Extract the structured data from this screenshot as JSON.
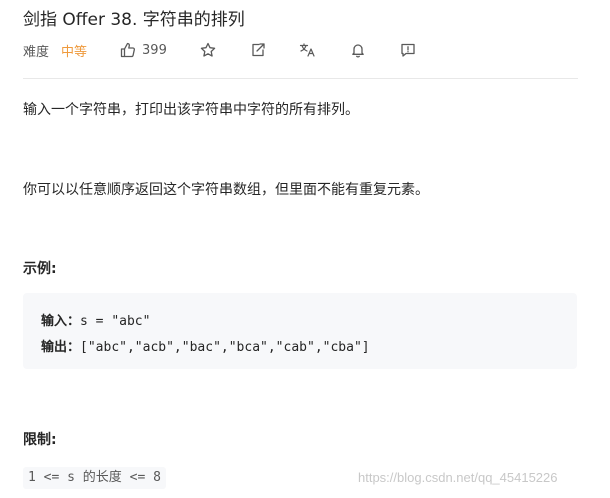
{
  "problem": {
    "title": "剑指 Offer 38. 字符串的排列",
    "difficulty_label": "难度",
    "difficulty": "中等",
    "likes": "399"
  },
  "toolbar_icons": [
    "thumbs-up-icon",
    "star-icon",
    "share-icon",
    "translate-icon",
    "bell-icon",
    "feedback-icon"
  ],
  "description": {
    "p1": "输入一个字符串，打印出该字符串中字符的所有排列。",
    "p2": "你可以以任意顺序返回这个字符串数组，但里面不能有重复元素。"
  },
  "example": {
    "heading": "示例:",
    "input_label": "输入：",
    "input_value": "s = \"abc\"",
    "output_label": "输出：",
    "output_value": "[\"abc\",\"acb\",\"bac\",\"bca\",\"cab\",\"cba\"]"
  },
  "constraints": {
    "heading": "限制:",
    "item": "1 <= s 的长度 <= 8"
  },
  "watermark": "https://blog.csdn.net/qq_45415226",
  "colors": {
    "difficulty": "#ef9a3d",
    "code_bg": "#f7f8fa",
    "divider": "#e8e8e8"
  }
}
